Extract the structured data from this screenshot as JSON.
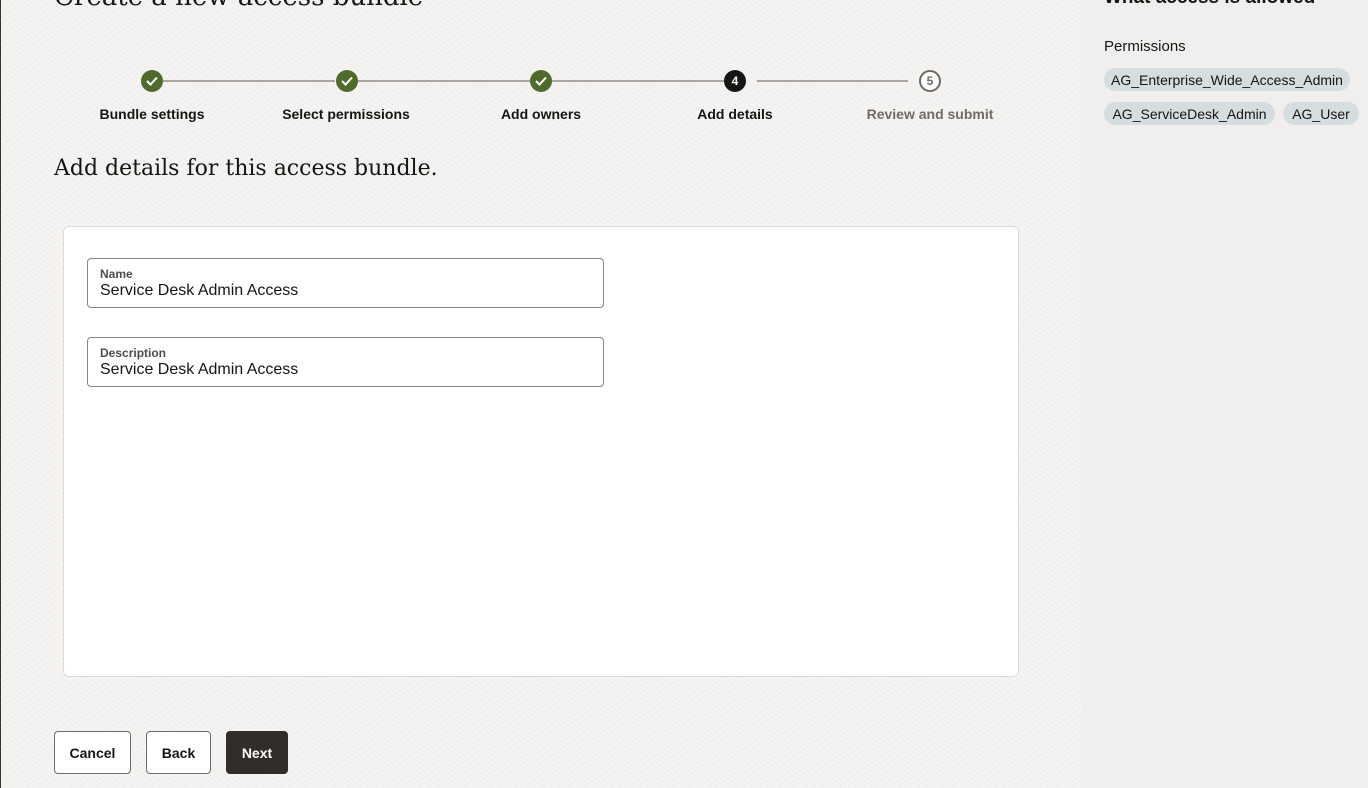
{
  "page_title": "Create a new access bundle",
  "stepper": {
    "steps": [
      {
        "label": "Bundle settings",
        "status": "done",
        "icon": "check-icon"
      },
      {
        "label": "Select permissions",
        "status": "done",
        "icon": "check-icon"
      },
      {
        "label": "Add owners",
        "status": "done",
        "icon": "check-icon"
      },
      {
        "label": "Add details",
        "status": "current",
        "number": "4"
      },
      {
        "label": "Review and submit",
        "status": "future",
        "number": "5"
      }
    ]
  },
  "section_heading": "Add details for this access bundle.",
  "form": {
    "name": {
      "label": "Name",
      "value": "Service Desk Admin Access"
    },
    "description": {
      "label": "Description",
      "value": "Service Desk Admin Access"
    }
  },
  "actions": {
    "cancel": "Cancel",
    "back": "Back",
    "next": "Next"
  },
  "side_panel": {
    "title": "What access is allowed",
    "permissions_label": "Permissions",
    "permissions": [
      "AG_Enterprise_Wide_Access_Admin",
      "AG_ServiceDesk_Admin",
      "AG_User"
    ]
  },
  "colors": {
    "done": "#4f6b2b",
    "current": "#161513",
    "chip": "#d4dde0",
    "primary_button": "#312d2a"
  }
}
